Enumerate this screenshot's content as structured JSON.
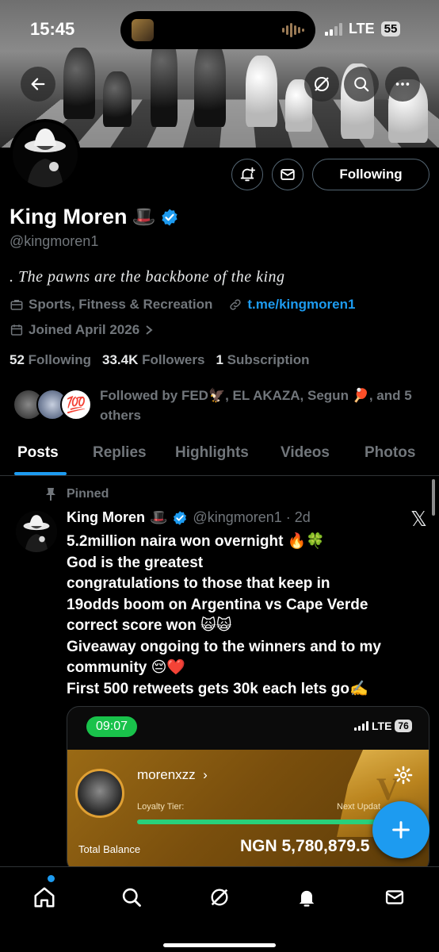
{
  "status_bar": {
    "time": "15:45",
    "network": "LTE",
    "battery": "55"
  },
  "profile": {
    "display_name": "King Moren",
    "name_emoji": "🎩",
    "handle": "@kingmoren1",
    "bio": ". The pawns are the backbone of the king",
    "category": "Sports, Fitness & Recreation",
    "link": "t.me/kingmoren1",
    "joined": "Joined April 2026",
    "following_button": "Following",
    "stats": {
      "following_count": "52",
      "following_label": "Following",
      "followers_count": "33.4K",
      "followers_label": "Followers",
      "subscriptions_count": "1",
      "subscriptions_label": "Subscription"
    },
    "followed_by": "Followed by FED🦅, EL AKAZA, Segun 🏓, and 5 others",
    "followed_badge": "💯"
  },
  "tabs": [
    {
      "label": "Posts"
    },
    {
      "label": "Replies"
    },
    {
      "label": "Highlights"
    },
    {
      "label": "Videos"
    },
    {
      "label": "Photos"
    }
  ],
  "pinned_post": {
    "pinned_label": "Pinned",
    "author": "King Moren",
    "author_emoji": "🎩",
    "meta": "@kingmoren1 · 2d",
    "lines": [
      "5.2million naira won overnight 🔥🍀",
      "God is the greatest",
      "congratulations to those that keep in",
      "19odds boom on Argentina vs Cape Verde",
      "correct score won 🙀🙀",
      "Giveaway ongoing to the winners and to my",
      "community 😔❤️",
      "First 500 retweets gets 30k each lets go✍️"
    ],
    "media": {
      "time": "09:07",
      "network": "LTE",
      "battery": "76",
      "username": "morenxzz",
      "loyalty_label": "Loyalty Tier:",
      "next_label": "Next Updat",
      "total_label": "Total Balance",
      "total_value": "NGN 5,780,879.5",
      "badge_letter": "V"
    }
  },
  "colors": {
    "accent": "#1d9bf0",
    "background": "#000000",
    "muted_text": "#71767b",
    "primary_text": "#e7e9ea"
  },
  "icons": {
    "back": "arrow-left-icon",
    "grok": "slash-circle-icon",
    "search": "search-icon",
    "more": "more-dots-icon",
    "notify": "bell-plus-icon",
    "message": "envelope-icon",
    "verified": "verified-badge-icon",
    "briefcase": "briefcase-icon",
    "link": "link-icon",
    "calendar": "calendar-icon",
    "pin": "pin-icon",
    "compose": "plus-icon",
    "home": "home-icon",
    "notifications": "bell-icon",
    "mail": "mail-icon"
  }
}
